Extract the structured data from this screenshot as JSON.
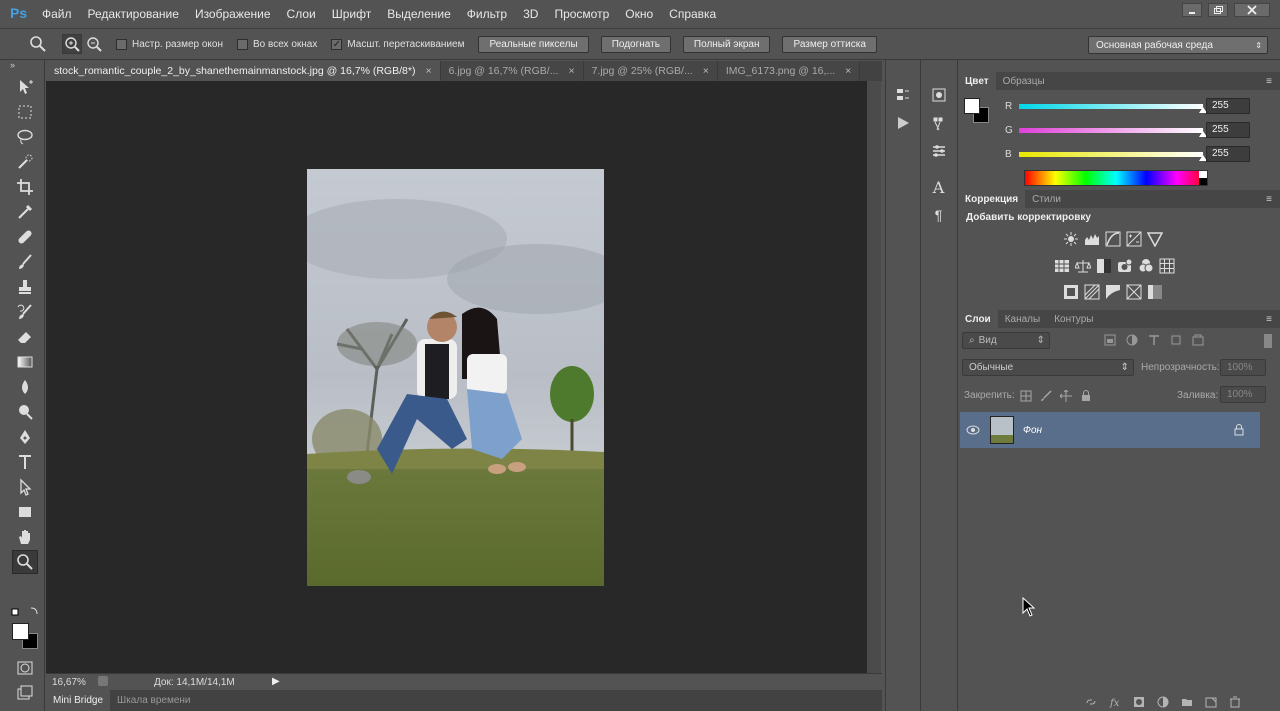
{
  "app": {
    "logo": "Ps"
  },
  "menu": [
    "Файл",
    "Редактирование",
    "Изображение",
    "Слои",
    "Шрифт",
    "Выделение",
    "Фильтр",
    "3D",
    "Просмотр",
    "Окно",
    "Справка"
  ],
  "options": {
    "checkboxes": [
      {
        "label": "Настр. размер окон",
        "checked": false
      },
      {
        "label": "Во всех окнах",
        "checked": false
      },
      {
        "label": "Масшт. перетаскиванием",
        "checked": true
      }
    ],
    "buttons": [
      "Реальные пикселы",
      "Подогнать",
      "Полный экран",
      "Размер оттиска"
    ],
    "workspace": "Основная рабочая среда"
  },
  "tabs": [
    {
      "label": "stock_romantic_couple_2_by_shanethemainmanstock.jpg @ 16,7% (RGB/8*)",
      "active": true
    },
    {
      "label": "6.jpg @ 16,7% (RGB/...",
      "active": false
    },
    {
      "label": "7.jpg @ 25% (RGB/...",
      "active": false
    },
    {
      "label": "IMG_6173.png @ 16,...",
      "active": false
    }
  ],
  "tab_close": "×",
  "status": {
    "zoom": "16,67%",
    "doc": "Док: 14,1M/14,1M"
  },
  "bottom_tabs": [
    "Mini Bridge",
    "Шкала времени"
  ],
  "color_panel": {
    "tabs": [
      "Цвет",
      "Образцы"
    ],
    "channels": [
      {
        "label": "R",
        "value": "255",
        "color": "#00d8e8"
      },
      {
        "label": "G",
        "value": "255",
        "color": "#e040d8"
      },
      {
        "label": "B",
        "value": "255",
        "color": "#e8e800"
      }
    ],
    "foreground": "#ffffff",
    "background": "#000000"
  },
  "adjust_panel": {
    "tabs": [
      "Коррекция",
      "Стили"
    ],
    "heading": "Добавить корректировку"
  },
  "layers_panel": {
    "tabs": [
      "Слои",
      "Каналы",
      "Контуры"
    ],
    "filter": "Вид",
    "blend_mode": "Обычные",
    "opacity_label": "Непрозрачность:",
    "opacity": "100%",
    "lock_label": "Закрепить:",
    "fill_label": "Заливка:",
    "fill": "100%",
    "layers": [
      {
        "name": "Фон",
        "locked": true,
        "visible": true
      }
    ]
  },
  "colors": {
    "accent": "#3fa2e6",
    "selected_layer": "#596e8a"
  }
}
